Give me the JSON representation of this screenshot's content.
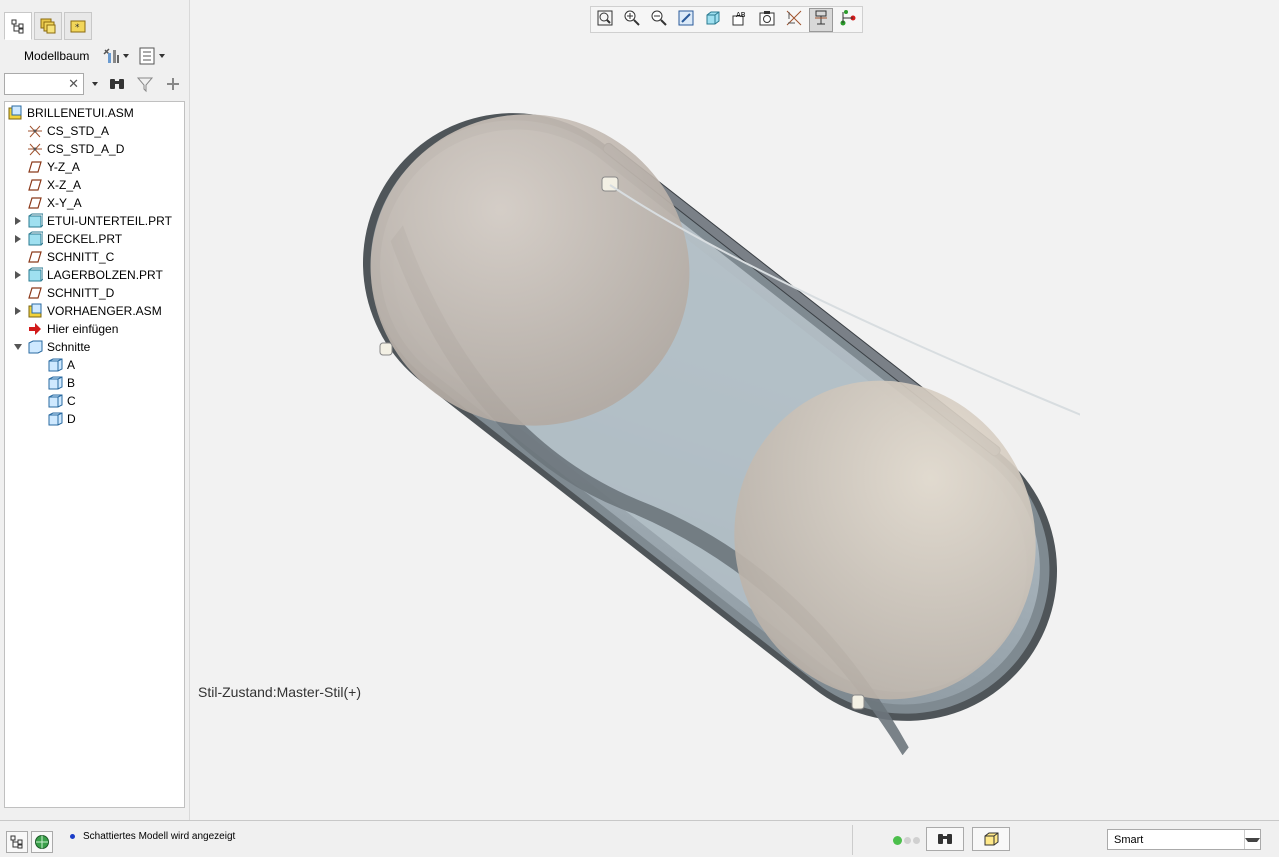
{
  "panel": {
    "tabs": [
      "model-tree-tab",
      "layer-tab",
      "favorites-tab"
    ],
    "tree_title": "Modellbaum",
    "search_value": ""
  },
  "tree": [
    {
      "label": "BRILLENETUI.ASM",
      "icon": "assembly-icon",
      "indent": 0,
      "expander": "none"
    },
    {
      "label": "CS_STD_A",
      "icon": "csys-icon",
      "indent": 1,
      "expander": "none"
    },
    {
      "label": "CS_STD_A_D",
      "icon": "csys-icon",
      "indent": 1,
      "expander": "none"
    },
    {
      "label": "Y-Z_A",
      "icon": "datum-plane-icon",
      "indent": 1,
      "expander": "none"
    },
    {
      "label": "X-Z_A",
      "icon": "datum-plane-icon",
      "indent": 1,
      "expander": "none"
    },
    {
      "label": "X-Y_A",
      "icon": "datum-plane-icon",
      "indent": 1,
      "expander": "none"
    },
    {
      "label": "ETUI-UNTERTEIL.PRT",
      "icon": "part-icon",
      "indent": 1,
      "expander": "collapsed"
    },
    {
      "label": "DECKEL.PRT",
      "icon": "part-icon",
      "indent": 1,
      "expander": "collapsed"
    },
    {
      "label": "SCHNITT_C",
      "icon": "datum-plane-icon",
      "indent": 1,
      "expander": "none"
    },
    {
      "label": "LAGERBOLZEN.PRT",
      "icon": "part-icon",
      "indent": 1,
      "expander": "collapsed"
    },
    {
      "label": "SCHNITT_D",
      "icon": "datum-plane-icon",
      "indent": 1,
      "expander": "none"
    },
    {
      "label": "VORHAENGER.ASM",
      "icon": "assembly-icon",
      "indent": 1,
      "expander": "collapsed"
    },
    {
      "label": "Hier einfügen",
      "icon": "insert-arrow-icon",
      "indent": 1,
      "expander": "none"
    },
    {
      "label": "Schnitte",
      "icon": "sections-folder-icon",
      "indent": 1,
      "expander": "expanded"
    },
    {
      "label": "A",
      "icon": "section-icon",
      "indent": 2,
      "expander": "none"
    },
    {
      "label": "B",
      "icon": "section-icon",
      "indent": 2,
      "expander": "none"
    },
    {
      "label": "C",
      "icon": "section-icon",
      "indent": 2,
      "expander": "none"
    },
    {
      "label": "D",
      "icon": "section-icon",
      "indent": 2,
      "expander": "none"
    }
  ],
  "view_toolbar": [
    {
      "icon": "refit-icon",
      "active": false
    },
    {
      "icon": "zoom-in-icon",
      "active": false
    },
    {
      "icon": "zoom-out-icon",
      "active": false
    },
    {
      "icon": "repaint-icon",
      "active": false
    },
    {
      "icon": "display-style-icon",
      "active": false
    },
    {
      "icon": "saved-views-icon",
      "active": false
    },
    {
      "icon": "view-manager-icon",
      "active": false
    },
    {
      "icon": "datum-display-icon",
      "active": false
    },
    {
      "icon": "annotation-display-icon",
      "active": true
    },
    {
      "icon": "spin-center-icon",
      "active": false
    }
  ],
  "viewport": {
    "style_state": "Stil-Zustand:Master-Stil(+)"
  },
  "status": {
    "message": "Schattiertes Modell wird angezeigt",
    "selection_filter": "Smart"
  }
}
